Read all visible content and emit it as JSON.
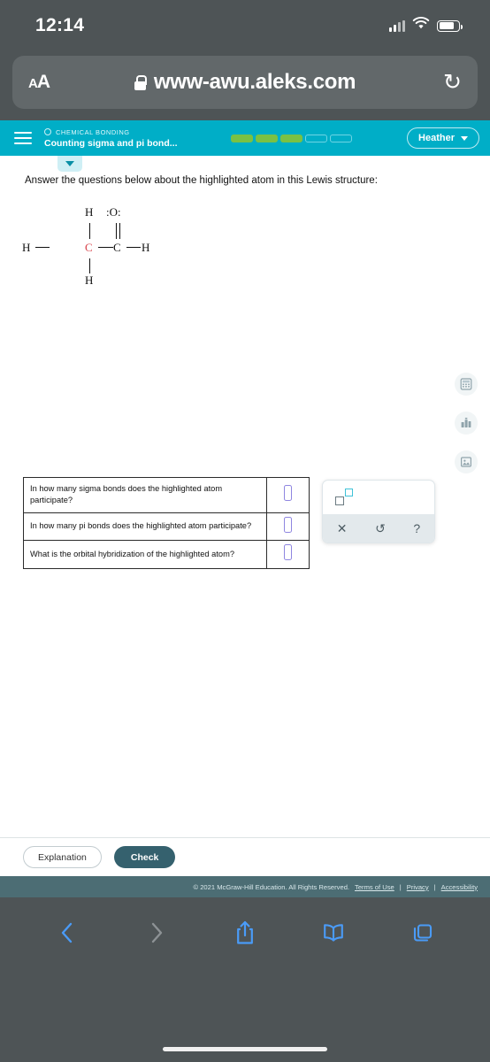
{
  "status_bar": {
    "time": "12:14",
    "signal_icon": "cellular-signal-icon",
    "wifi_icon": "wifi-icon",
    "battery_icon": "battery-icon"
  },
  "browser": {
    "text_size_label": "AA",
    "lock_icon": "lock-icon",
    "url": "www-awu.aleks.com",
    "reload_icon": "reload-icon",
    "reload_glyph": "↻"
  },
  "aleks_header": {
    "menu_icon": "hamburger-menu-icon",
    "kicker": "CHEMICAL BONDING",
    "title": "Counting sigma and pi bond...",
    "progress_total": 5,
    "progress_filled": 3,
    "progress_fill_color": "#7ac143",
    "user_name": "Heather",
    "user_chevron_icon": "chevron-down-icon",
    "collapse_icon": "chevron-down-icon",
    "bg_color": "#00aec7"
  },
  "content": {
    "prompt": "Answer the questions below about the highlighted atom in this Lewis structure:",
    "lewis_structure": {
      "name": "acetaldehyde",
      "highlight_color": "#d8424a",
      "labels": {
        "top_h": "H",
        "oxygen": ":O:",
        "left_h": "H",
        "carbon_highlighted": "C",
        "carbon_right": "C",
        "right_h": "H",
        "bottom_h": "H"
      }
    }
  },
  "rail_icons": [
    {
      "name": "calculator-icon"
    },
    {
      "name": "periodic-table-chart-icon"
    },
    {
      "name": "reference-image-icon"
    }
  ],
  "questions": [
    {
      "text": "In how many sigma bonds does the highlighted atom participate?",
      "answer": ""
    },
    {
      "text": "In how many pi bonds does the highlighted atom participate?",
      "answer": ""
    },
    {
      "text": "What is the orbital hybridization of the highlighted atom?",
      "answer": ""
    }
  ],
  "palette": {
    "superscript_icon": "superscript-tool-icon",
    "clear_label": "✕",
    "undo_label": "↺",
    "help_label": "?",
    "clear_icon": "clear-icon",
    "undo_icon": "undo-icon",
    "help_icon": "help-icon"
  },
  "actions": {
    "explanation_label": "Explanation",
    "check_label": "Check",
    "check_color": "#35616e"
  },
  "footer": {
    "copyright": "© 2021 McGraw-Hill Education. All Rights Reserved.",
    "terms": "Terms of Use",
    "privacy": "Privacy",
    "accessibility": "Accessibility",
    "separator": "|"
  },
  "ios_toolbar": {
    "back_icon": "back-chevron-icon",
    "forward_icon": "forward-chevron-icon",
    "share_icon": "share-icon",
    "bookmarks_icon": "bookmarks-book-icon",
    "tabs_icon": "tabs-icon",
    "home_indicator": "home-indicator"
  }
}
